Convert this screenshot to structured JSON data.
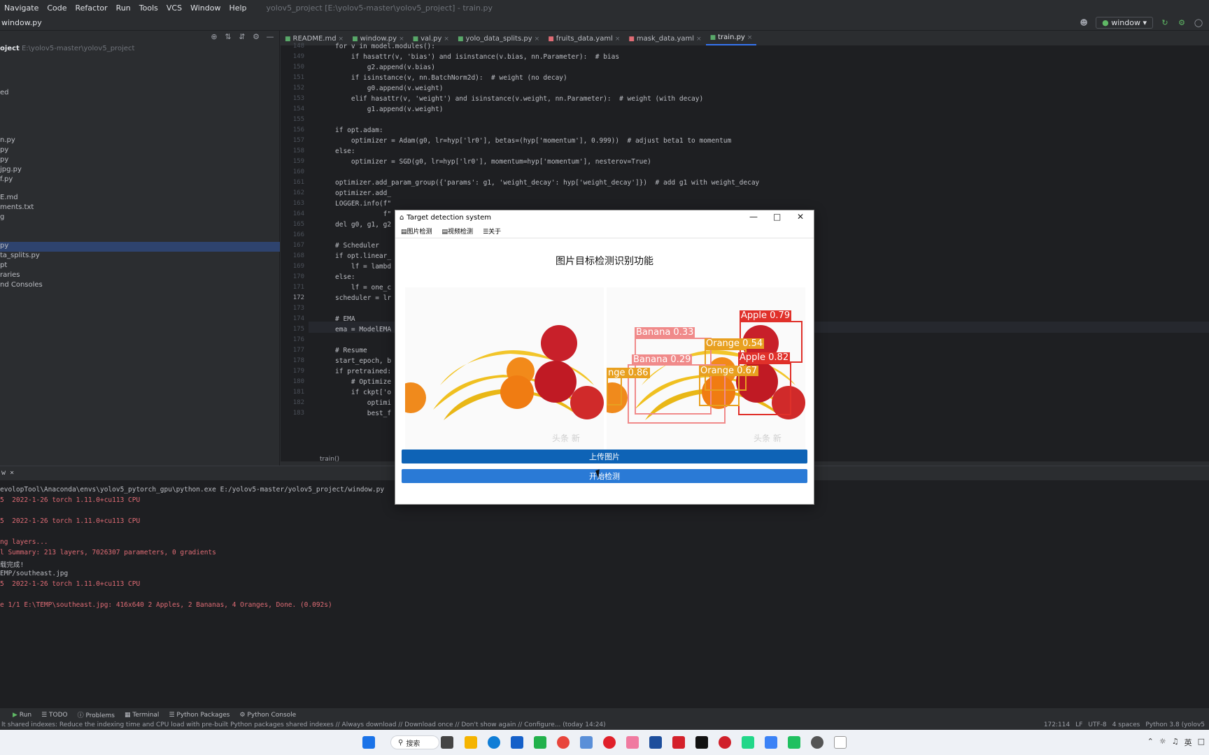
{
  "menubar": {
    "items": [
      "Navigate",
      "Code",
      "Refactor",
      "Run",
      "Tools",
      "VCS",
      "Window",
      "Help"
    ],
    "title": "yolov5_project [E:\\yolov5-master\\yolov5_project] - train.py"
  },
  "navbar": {
    "file": "window.py",
    "run_config": "window"
  },
  "project": {
    "root_label": "oject",
    "root_path": "E:\\yolov5-master\\yolov5_project",
    "items": [
      "ed",
      "n.py",
      "py",
      "py",
      "jpg.py",
      "f.py",
      "",
      "E.md",
      "ments.txt",
      "g",
      "",
      "py",
      "ta_splits.py",
      "pt",
      "raries",
      "nd Consoles"
    ]
  },
  "tabs": [
    {
      "label": "README.md",
      "active": false
    },
    {
      "label": "window.py",
      "active": false
    },
    {
      "label": "val.py",
      "active": false
    },
    {
      "label": "yolo_data_splits.py",
      "active": false
    },
    {
      "label": "fruits_data.yaml",
      "active": false
    },
    {
      "label": "mask_data.yaml",
      "active": false
    },
    {
      "label": "train.py",
      "active": true
    }
  ],
  "editor": {
    "current_line": 172,
    "lines": [
      {
        "n": 148,
        "t": "for v in model.modules():"
      },
      {
        "n": 149,
        "t": "    if hasattr(v, 'bias') and isinstance(v.bias, nn.Parameter):  # bias"
      },
      {
        "n": 150,
        "t": "        g2.append(v.bias)"
      },
      {
        "n": 151,
        "t": "    if isinstance(v, nn.BatchNorm2d):  # weight (no decay)"
      },
      {
        "n": 152,
        "t": "        g0.append(v.weight)"
      },
      {
        "n": 153,
        "t": "    elif hasattr(v, 'weight') and isinstance(v.weight, nn.Parameter):  # weight (with decay)"
      },
      {
        "n": 154,
        "t": "        g1.append(v.weight)"
      },
      {
        "n": 155,
        "t": ""
      },
      {
        "n": 156,
        "t": "if opt.adam:"
      },
      {
        "n": 157,
        "t": "    optimizer = Adam(g0, lr=hyp['lr0'], betas=(hyp['momentum'], 0.999))  # adjust beta1 to momentum"
      },
      {
        "n": 158,
        "t": "else:"
      },
      {
        "n": 159,
        "t": "    optimizer = SGD(g0, lr=hyp['lr0'], momentum=hyp['momentum'], nesterov=True)"
      },
      {
        "n": 160,
        "t": ""
      },
      {
        "n": 161,
        "t": "optimizer.add_param_group({'params': g1, 'weight_decay': hyp['weight_decay']})  # add g1 with weight_decay"
      },
      {
        "n": 162,
        "t": "optimizer.add_"
      },
      {
        "n": 163,
        "t": "LOGGER.info(f\""
      },
      {
        "n": 164,
        "t": "            f\""
      },
      {
        "n": 165,
        "t": "del g0, g1, g2"
      },
      {
        "n": 166,
        "t": ""
      },
      {
        "n": 167,
        "t": "# Scheduler"
      },
      {
        "n": 168,
        "t": "if opt.linear_"
      },
      {
        "n": 169,
        "t": "    lf = lambd"
      },
      {
        "n": 170,
        "t": "else:"
      },
      {
        "n": 171,
        "t": "    lf = one_c"
      },
      {
        "n": 172,
        "t": "scheduler = lr"
      },
      {
        "n": 173,
        "t": ""
      },
      {
        "n": 174,
        "t": "# EMA"
      },
      {
        "n": 175,
        "t": "ema = ModelEMA"
      },
      {
        "n": 176,
        "t": ""
      },
      {
        "n": 177,
        "t": "# Resume"
      },
      {
        "n": 178,
        "t": "start_epoch, b"
      },
      {
        "n": 179,
        "t": "if pretrained:"
      },
      {
        "n": 180,
        "t": "    # Optimize"
      },
      {
        "n": 181,
        "t": "    if ckpt['o"
      },
      {
        "n": 182,
        "t": "        optimi"
      },
      {
        "n": 183,
        "t": "        best_f"
      }
    ],
    "breadcrumb": "train()"
  },
  "run": {
    "tab": "w",
    "console": [
      {
        "t": "evolopTool\\Anaconda\\envs\\yolov5_pytorch_gpu\\python.exe E:/yolov5-master/yolov5_project/window.py",
        "c": "gray"
      },
      {
        "t": "5  2022-1-26 torch 1.11.0+cu113 CPU",
        "c": "red"
      },
      {
        "t": "",
        "c": "red"
      },
      {
        "t": "5  2022-1-26 torch 1.11.0+cu113 CPU",
        "c": "red"
      },
      {
        "t": "",
        "c": "red"
      },
      {
        "t": "ng layers...",
        "c": "red"
      },
      {
        "t": "l Summary: 213 layers, 7026307 parameters, 0 gradients",
        "c": "red"
      },
      {
        "t": "载完成!",
        "c": "gray"
      },
      {
        "t": "EMP/southeast.jpg",
        "c": "gray"
      },
      {
        "t": "5  2022-1-26 torch 1.11.0+cu113 CPU",
        "c": "red"
      },
      {
        "t": "",
        "c": "red"
      },
      {
        "t": "e 1/1 E:\\TEMP\\southeast.jpg: 416x640 2 Apples, 2 Bananas, 4 Oranges, Done. (0.092s)",
        "c": "red"
      }
    ]
  },
  "toolwindows": [
    "Run",
    "TODO",
    "Problems",
    "Terminal",
    "Python Packages",
    "Python Console"
  ],
  "status": {
    "message": "lt shared indexes: Reduce the indexing time and CPU load with pre-built Python packages shared indexes // Always download // Download once // Don't show again // Configure... (today 14:24)",
    "position": "172:114",
    "line_sep": "LF",
    "encoding": "UTF-8",
    "indent": "4 spaces",
    "interpreter": "Python 3.8 (yolov5"
  },
  "taskbar": {
    "search": "搜索",
    "tray_lang": "英"
  },
  "dialog": {
    "title": "Target detection system",
    "menu": [
      "图片检测",
      "视频检测",
      "关于"
    ],
    "heading": "图片目标检测识别功能",
    "upload_button": "上传图片",
    "detect_button": "开始检测",
    "watermark": "头条 新",
    "detections": [
      {
        "label": "Apple 0.79",
        "color": "#e0302a"
      },
      {
        "label": "Banana 0.33",
        "color": "#f08a8a"
      },
      {
        "label": "Orange 0.54",
        "color": "#e8a020"
      },
      {
        "label": "Banana 0.29",
        "color": "#f08a8a"
      },
      {
        "label": "Apple 0.82",
        "color": "#e0302a"
      },
      {
        "label": "Orange 0.67",
        "color": "#e8a020"
      },
      {
        "label": "nge 0.86",
        "color": "#e8a020"
      }
    ]
  }
}
